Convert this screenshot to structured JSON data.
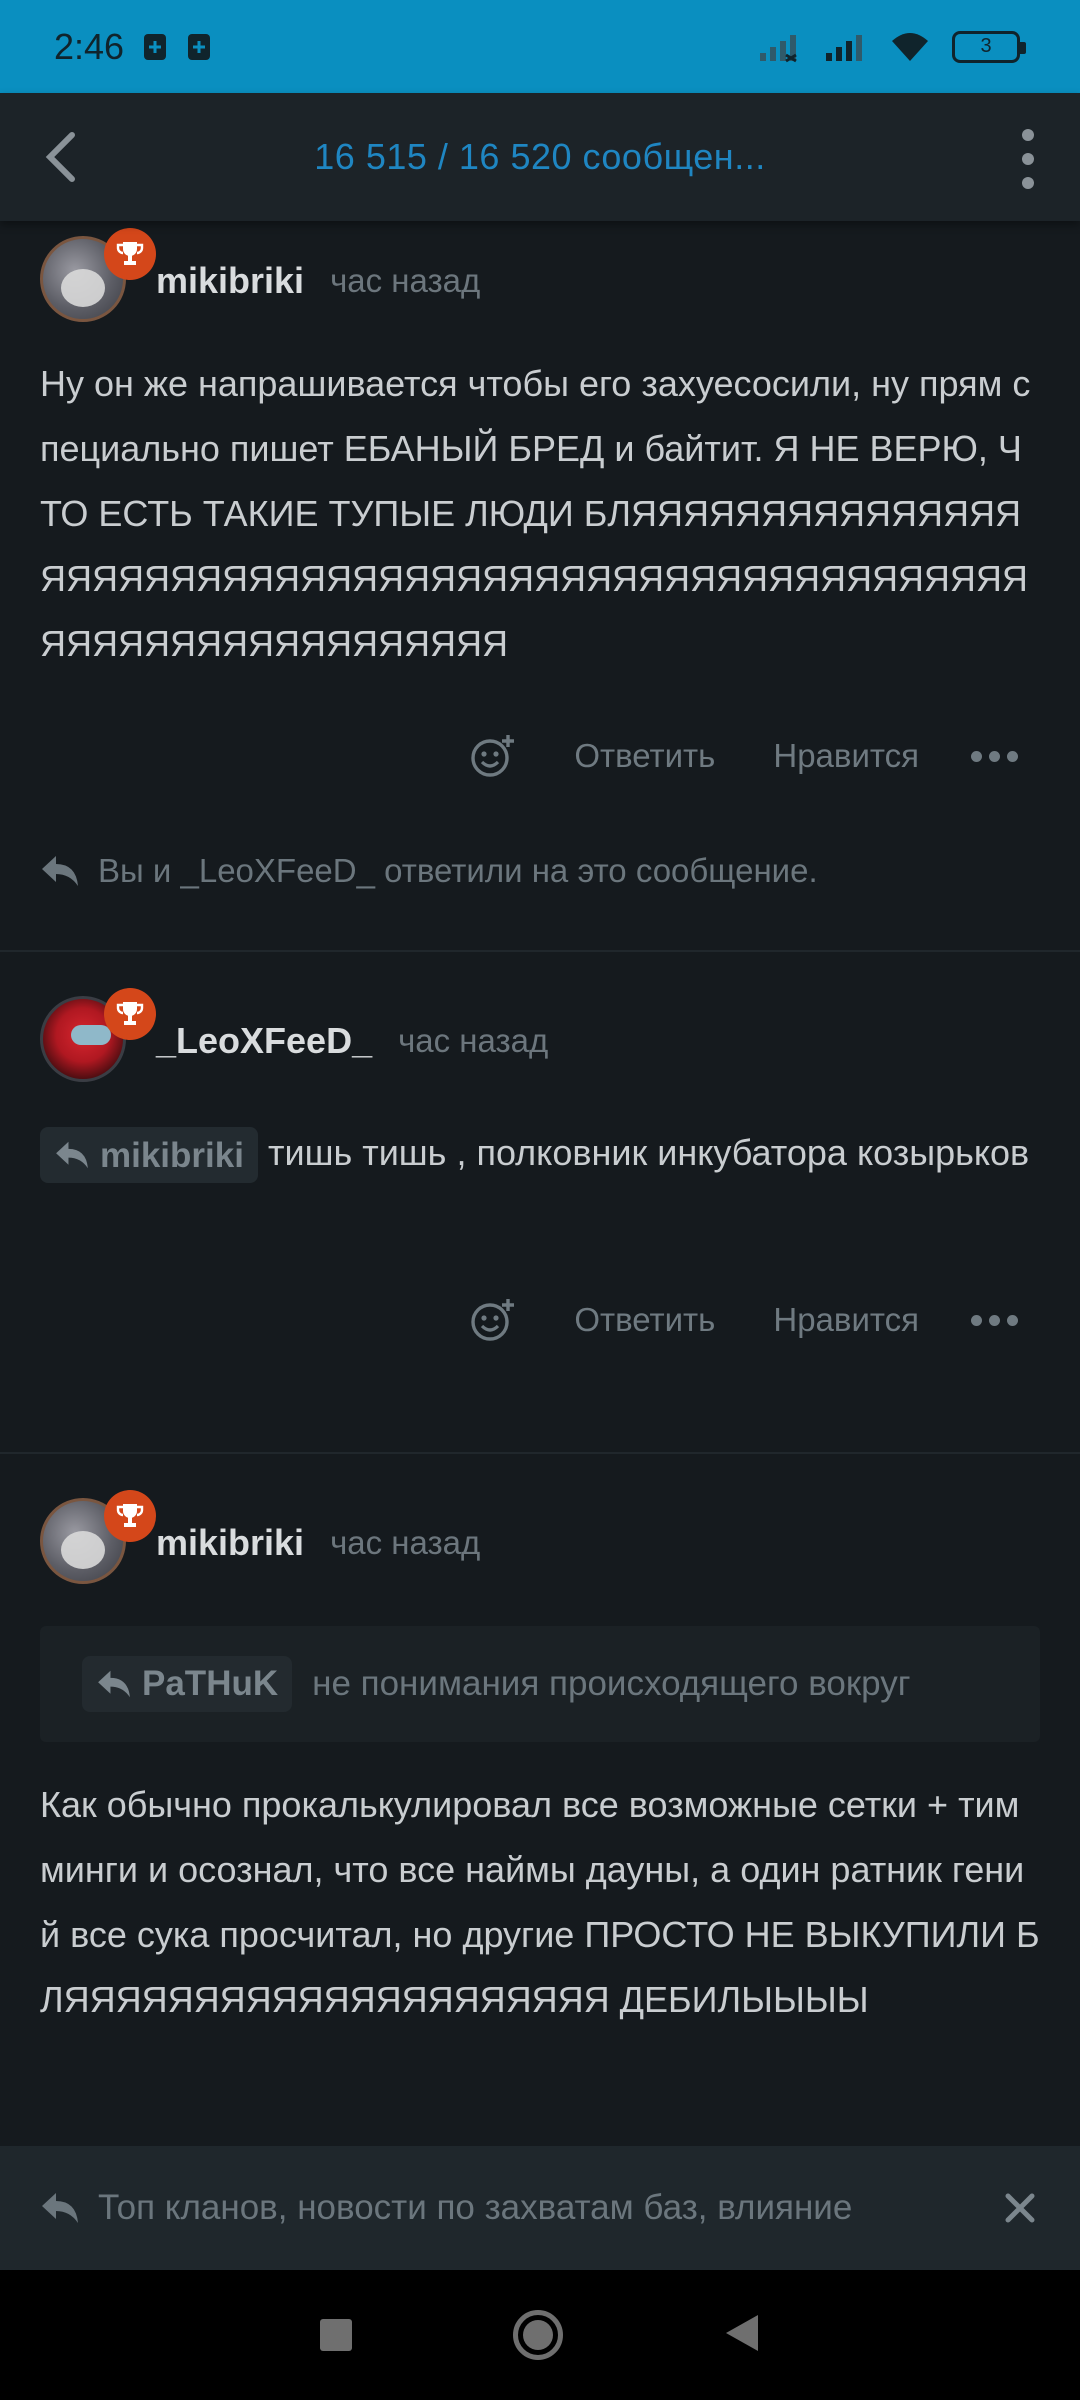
{
  "status_bar": {
    "time": "2:46",
    "battery_level": "3",
    "icons": [
      "sim-card-icon",
      "sim-card-icon",
      "signal-weak-icon",
      "signal-strong-icon",
      "wifi-icon",
      "battery-icon"
    ]
  },
  "header": {
    "title": "16 515 / 16 520 сообщен...",
    "back_icon": "back-arrow-icon",
    "menu_icon": "more-vertical-icon"
  },
  "posts": [
    {
      "username": "mikibriki",
      "time": "час назад",
      "body": "Ну он же напрашивается чтобы его захуесосили, ну прям специально пишет ЕБАНЫЙ БРЕД и байтит. Я НЕ ВЕРЮ, ЧТО ЕСТЬ ТАКИЕ ТУПЫЕ ЛЮДИ БЛЯЯЯЯЯЯЯЯЯЯЯЯЯЯЯЯЯЯЯЯЯЯЯЯЯЯЯЯЯЯЯЯЯЯЯЯЯЯЯЯЯЯЯЯЯЯЯЯЯЯЯЯЯЯЯЯЯЯЯЯЯЯЯЯЯЯЯЯЯЯЯ",
      "reply_label": "Ответить",
      "like_label": "Нравится",
      "reply_note": "Вы и _LeoXFeeD_ ответили на это сообщение."
    },
    {
      "username": "_LeoXFeeD_",
      "time": "час назад",
      "mention": "mikibriki",
      "body": "тишь тишь , полковник инкубатора козырьков",
      "reply_label": "Ответить",
      "like_label": "Нравится"
    },
    {
      "username": "mikibriki",
      "time": "час назад",
      "quote_mention": "PaTHuK",
      "quote_text": "не понимания происходящего вокруг",
      "body": "Как обычно прокалькулировал все возможные сетки + тимминги и осознал, что все наймы дауны, а один ратник гений все сука просчитал, но другие ПРОСТО НЕ ВЫКУПИЛИ БЛЯЯЯЯЯЯЯЯЯЯЯЯЯЯЯЯЯЯЯЯЯ ДЕБИЛЫЫЫЫ"
    }
  ],
  "reply_bar": {
    "text": "Топ кланов, новости по захватам баз, влияние"
  },
  "colors": {
    "status_bar": "#0a8fc0",
    "accent_title": "#1f86c2",
    "background": "#151a1e",
    "badge": "#d4471a"
  }
}
